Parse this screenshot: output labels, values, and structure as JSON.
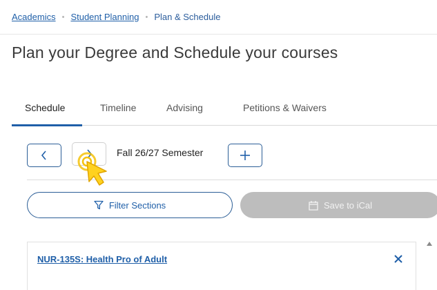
{
  "breadcrumb": {
    "items": [
      {
        "label": "Academics"
      },
      {
        "label": "Student Planning"
      },
      {
        "label": "Plan & Schedule"
      }
    ],
    "separator": "•"
  },
  "page": {
    "title": "Plan your Degree and Schedule your courses"
  },
  "tabs": [
    {
      "label": "Schedule",
      "active": true
    },
    {
      "label": "Timeline"
    },
    {
      "label": "Advising"
    },
    {
      "label": "Petitions & Waivers"
    }
  ],
  "schedule": {
    "prev_icon": "chevron-left-icon",
    "next_icon": "chevron-right-icon",
    "semester_label": "Fall 26/27 Semester",
    "add_icon": "plus-icon",
    "filter_label": "Filter Sections",
    "ical_label": "Save to iCal",
    "courses": [
      {
        "title": "NUR-135S: Health Pro of Adult",
        "remove_icon": "close-icon"
      }
    ]
  },
  "colors": {
    "accent": "#1f5fa8",
    "disabled": "#bdbdbd",
    "cursor": "#f5c20a"
  }
}
